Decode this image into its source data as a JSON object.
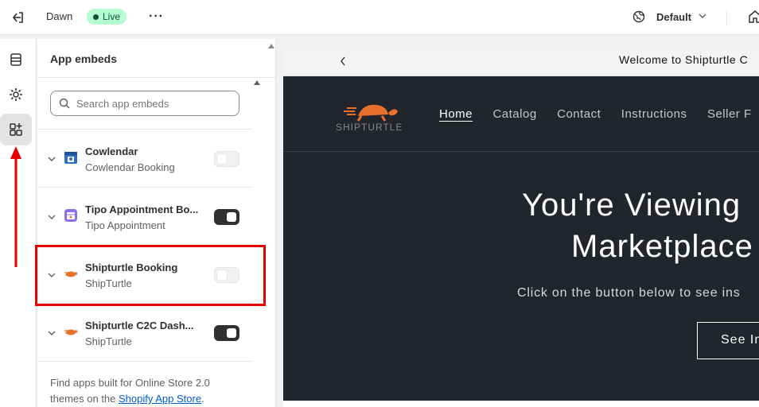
{
  "topbar": {
    "theme_name": "Dawn",
    "status_badge": "Live",
    "more_label": "···",
    "view_label": "Default"
  },
  "panel": {
    "title": "App embeds",
    "search_placeholder": "Search app embeds",
    "items": [
      {
        "name": "Cowlendar",
        "sub": "Cowlendar Booking",
        "enabled": false
      },
      {
        "name": "Tipo Appointment Bo...",
        "sub": "Tipo Appointment",
        "enabled": true
      },
      {
        "name": "Shipturtle Booking",
        "sub": "ShipTurtle",
        "enabled": false
      },
      {
        "name": "Shipturtle C2C Dash...",
        "sub": "ShipTurtle",
        "enabled": true
      }
    ],
    "footnote_text": "Find apps built for Online Store 2.0 themes on the ",
    "footnote_link": "Shopify App Store",
    "footnote_end": "."
  },
  "preview": {
    "announcement": "Welcome to Shipturtle C",
    "brand_name": "SHIPTURTLE",
    "nav": [
      "Home",
      "Catalog",
      "Contact",
      "Instructions",
      "Seller F"
    ],
    "hero_line1": "You're Viewing",
    "hero_line2": "Marketplace",
    "hero_sub": "Click on the button below to see ins",
    "hero_button": "See In"
  },
  "colors": {
    "accent_highlight": "#e60000",
    "live_badge_bg": "#b4fed2",
    "link": "#005bd3",
    "brand_orange": "#e8702a",
    "site_bg": "#22252c"
  }
}
